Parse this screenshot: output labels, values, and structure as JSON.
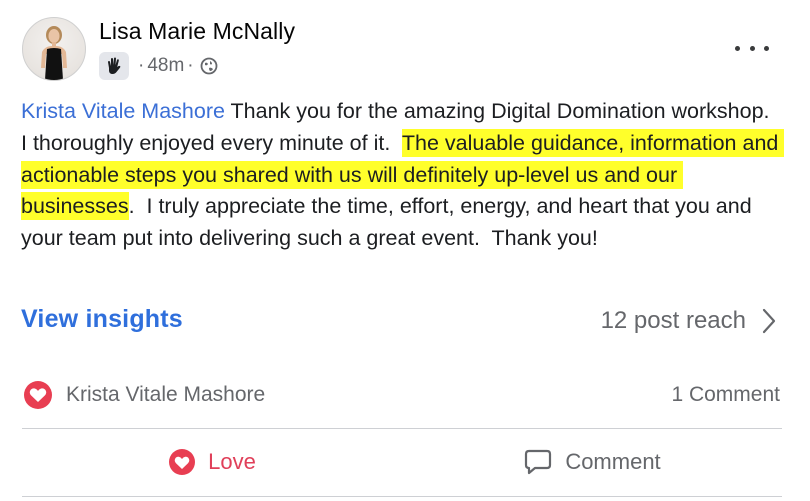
{
  "post": {
    "author": "Lisa Marie McNally",
    "time": "48m",
    "meta_sep": "·",
    "badge_icon": "waving-hand-icon",
    "audience_icon": "globe-icon",
    "menu_icon": "more-horizontal-icon",
    "text": {
      "mention": "Krista Vitale Mashore",
      "part1": " Thank you for the amazing Digital Domination workshop.  I thoroughly enjoyed every minute of it.  ",
      "highlighted": "The valuable guidance, information and actionable steps you shared with us will definitely up-level us and our businesses",
      "part2": ".  I truly appreciate the time, effort, energy, and heart that you and your team put into delivering such a great event.  Thank you!"
    },
    "highlight_color": "#ffff2b"
  },
  "insights": {
    "link_label": "View insights",
    "reach_label": "12 post reach",
    "reach_icon": "chevron-right-icon"
  },
  "reactions": {
    "icon": "heart-icon",
    "names": "Krista Vitale Mashore",
    "comment_count": "1 Comment"
  },
  "actions": {
    "love_label": "Love",
    "love_icon": "heart-icon",
    "comment_label": "Comment",
    "comment_icon": "speech-bubble-icon"
  },
  "colors": {
    "link": "#2f6fdc",
    "mention": "#3b6fd6",
    "love": "#e0405a",
    "secondary_text": "#65676b"
  }
}
